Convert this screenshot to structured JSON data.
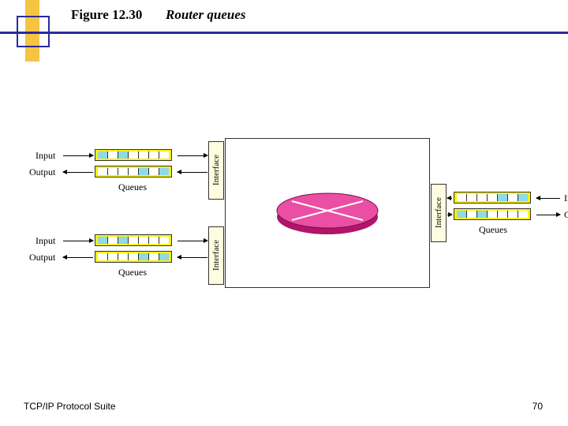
{
  "header": {
    "figure": "Figure 12.30",
    "title": "Router queues"
  },
  "footer": {
    "left": "TCP/IP Protocol Suite",
    "page": "70"
  },
  "labels": {
    "interface": "Interface",
    "queues": "Queues",
    "input": "Input",
    "output": "Output"
  },
  "colors": {
    "queue_frame": "#fff200",
    "cell_filled": "#8fd9e8",
    "cell_empty": "#ffffff",
    "disk_side": "#b01568",
    "disk_top": "#ea4fa3",
    "rule": "#2a2a9a"
  },
  "chart_data": {
    "type": "diagram",
    "description": "Router with three interfaces, each having an input queue and an output queue",
    "interfaces": [
      {
        "side": "left",
        "pos": "top",
        "input_fill": [
          1,
          0,
          1,
          0,
          0,
          0,
          0
        ],
        "output_fill": [
          0,
          0,
          0,
          0,
          1,
          0,
          1
        ]
      },
      {
        "side": "left",
        "pos": "bottom",
        "input_fill": [
          1,
          0,
          1,
          0,
          0,
          0,
          0
        ],
        "output_fill": [
          0,
          0,
          0,
          0,
          1,
          0,
          1
        ]
      },
      {
        "side": "right",
        "pos": "mid",
        "input_fill": [
          0,
          0,
          0,
          0,
          1,
          0,
          1
        ],
        "output_fill": [
          1,
          0,
          1,
          0,
          0,
          0,
          0
        ]
      }
    ]
  }
}
